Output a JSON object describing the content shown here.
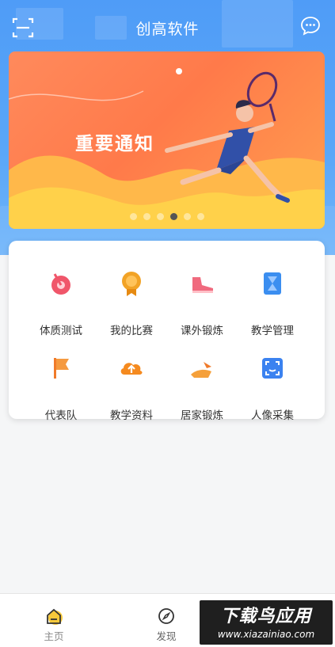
{
  "header": {
    "title": "创高软件",
    "scan_icon": "scan-icon",
    "message_icon": "chat-bubble-icon"
  },
  "banner": {
    "title": "重要通知",
    "dot_count": 6,
    "active_dot_index": 3
  },
  "grid": {
    "items": [
      {
        "label": "体质测试",
        "icon": "fitness-test-icon",
        "color": "#f0566a"
      },
      {
        "label": "我的比赛",
        "icon": "medal-icon",
        "color": "#f2a326"
      },
      {
        "label": "课外锻炼",
        "icon": "sneaker-icon",
        "color": "#f06a7e"
      },
      {
        "label": "教学管理",
        "icon": "hourglass-icon",
        "color": "#3b8ef0"
      },
      {
        "label": "代表队",
        "icon": "flag-icon",
        "color": "#f07a2a"
      },
      {
        "label": "教学资料",
        "icon": "cloud-upload-icon",
        "color": "#f58a1f"
      },
      {
        "label": "居家锻炼",
        "icon": "home-exercise-icon",
        "color": "#f5a03a"
      },
      {
        "label": "人像采集",
        "icon": "face-scan-icon",
        "color": "#3b82f0"
      }
    ]
  },
  "bottom_nav": {
    "items": [
      {
        "label": "主页",
        "icon": "home-icon"
      },
      {
        "label": "发现",
        "icon": "compass-icon"
      }
    ]
  },
  "watermark": {
    "main": "下载鸟应用",
    "sub": "www.xiazainiao.com"
  },
  "colors": {
    "header_blue": "#4f9cf7",
    "banner_orange": "#ff7a4a",
    "active_dot": "#555555"
  }
}
